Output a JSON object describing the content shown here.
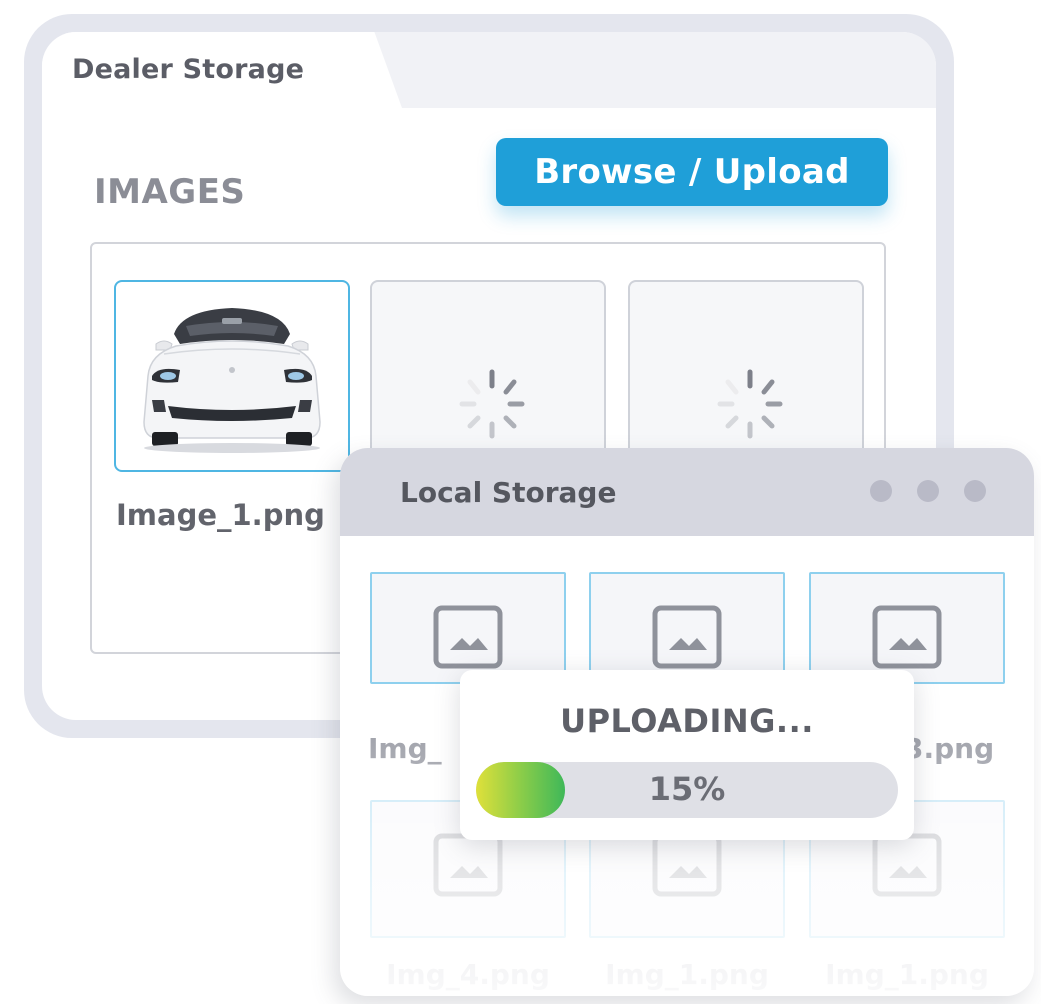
{
  "dealer_storage": {
    "title": "Dealer Storage",
    "section_label": "IMAGES",
    "browse_button_label": "Browse / Upload",
    "images": [
      {
        "file_name": "Image_1.png",
        "state": "loaded",
        "icon": "car-photo"
      },
      {
        "file_name": "",
        "state": "loading",
        "icon": "spinner-icon"
      },
      {
        "file_name": "",
        "state": "loading",
        "icon": "spinner-icon"
      }
    ]
  },
  "local_storage": {
    "title": "Local Storage",
    "window_controls": [
      "dot-button",
      "dot-button",
      "dot-button"
    ],
    "files": [
      {
        "name": "Img_",
        "icon": "image-icon"
      },
      {
        "name": "",
        "icon": "image-icon"
      },
      {
        "name": "3.png",
        "icon": "image-icon"
      },
      {
        "name": "Img_4.png",
        "icon": "image-icon"
      },
      {
        "name": "Img_1.png",
        "icon": "image-icon"
      },
      {
        "name": "Img_1.png",
        "icon": "image-icon"
      }
    ]
  },
  "upload_status": {
    "label": "UPLOADING...",
    "progress_percent": 15,
    "progress_text": "15%"
  },
  "colors": {
    "accent": "#1f9fd8",
    "selected_border": "#4fb6e3",
    "progress_start": "#dfe03a",
    "progress_end": "#3fb859"
  }
}
